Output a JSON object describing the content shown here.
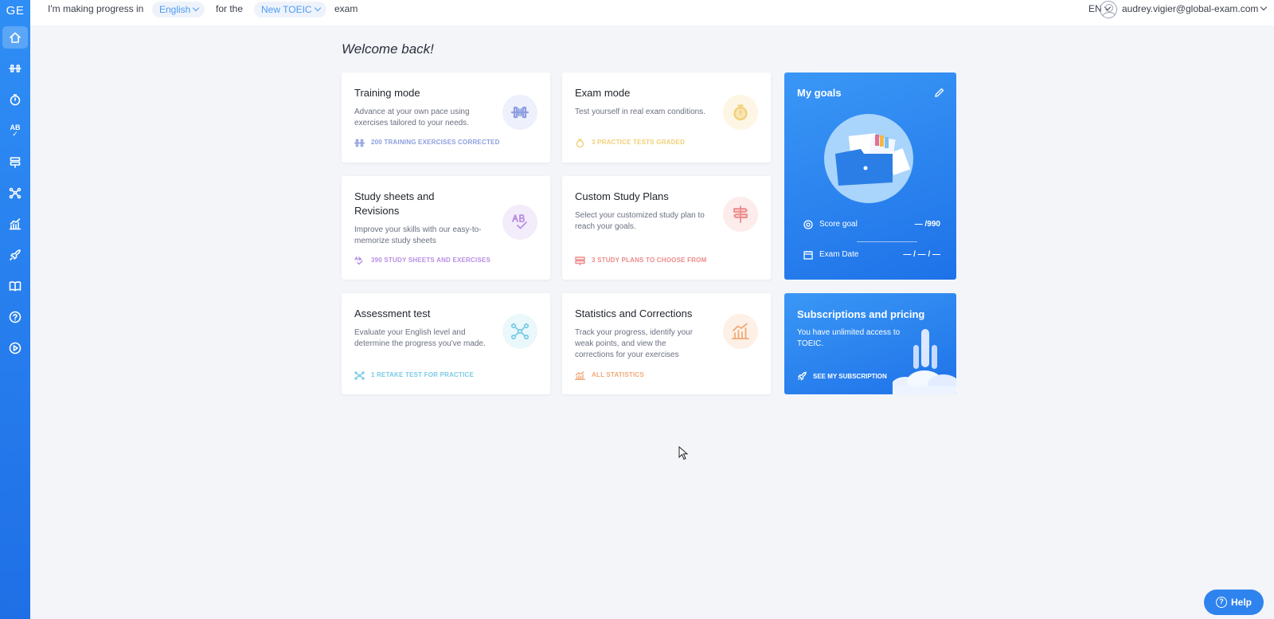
{
  "app": {
    "logo": "GE"
  },
  "sidebar": {
    "items": [
      {
        "name": "home",
        "icon": "home-icon",
        "active": true
      },
      {
        "name": "training",
        "icon": "dumbbell-icon"
      },
      {
        "name": "exam",
        "icon": "stopwatch-icon"
      },
      {
        "name": "study-sheets",
        "icon": "ab-check-icon",
        "text": "AB"
      },
      {
        "name": "study-plans",
        "icon": "signpost-icon"
      },
      {
        "name": "assessment",
        "icon": "network-icon"
      },
      {
        "name": "statistics",
        "icon": "chart-icon"
      },
      {
        "name": "subscription",
        "icon": "rocket-icon"
      },
      {
        "name": "resources",
        "icon": "book-icon"
      },
      {
        "name": "help",
        "icon": "question-icon"
      },
      {
        "name": "videos",
        "icon": "play-icon"
      }
    ]
  },
  "topbar": {
    "prefix": "I'm making progress in",
    "language": "English",
    "middle": "for the",
    "exam": "New TOEIC",
    "suffix": "exam",
    "ui_lang": "EN",
    "user_email": "audrey.vigier@global-exam.com"
  },
  "main": {
    "welcome": "Welcome back!",
    "cards": {
      "training": {
        "title": "Training mode",
        "desc": "Advance at your own pace using exercises tailored to your needs.",
        "meta": "200 TRAINING EXERCISES CORRECTED",
        "color": "#8c9ee0"
      },
      "exam": {
        "title": "Exam mode",
        "desc": "Test yourself in real exam conditions.",
        "meta": "3 PRACTICE TESTS GRADED",
        "color": "#f2cf77"
      },
      "sheets": {
        "title": "Study sheets and Revisions",
        "desc": "Improve your skills with our easy-to-memorize study sheets",
        "meta": "390 STUDY SHEETS AND EXERCISES",
        "color": "#b88ee4"
      },
      "plans": {
        "title": "Custom Study Plans",
        "desc": "Select your customized study plan to reach your goals.",
        "meta": "3 STUDY PLANS TO CHOOSE FROM",
        "color": "#ec8a8a"
      },
      "assessment": {
        "title": "Assessment test",
        "desc": "Evaluate your English level and determine the progress you've made.",
        "meta": "1 RETAKE TEST FOR PRACTICE",
        "color": "#7ccbe6"
      },
      "stats": {
        "title": "Statistics and Corrections",
        "desc": "Track your progress, identify your weak points, and view the corrections for your exercises",
        "meta": "ALL STATISTICS",
        "color": "#f0a977"
      }
    },
    "goals": {
      "title": "My goals",
      "score_label": "Score goal",
      "score_value": "— /990",
      "date_label": "Exam Date",
      "date_value": "— / — / —"
    },
    "subscription": {
      "title": "Subscriptions and pricing",
      "desc": "You have unlimited access to TOEIC.",
      "cta": "SEE MY SUBSCRIPTION"
    }
  },
  "help": {
    "label": "Help"
  }
}
